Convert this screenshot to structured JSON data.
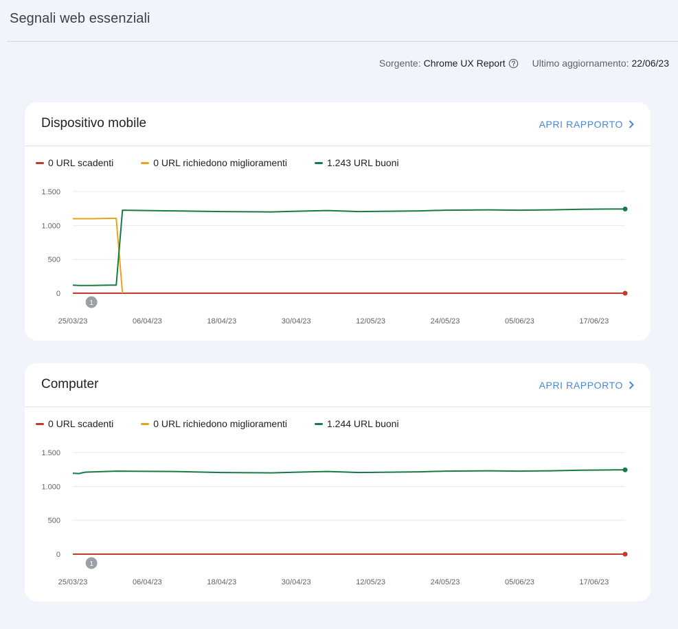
{
  "page": {
    "title": "Segnali web essenziali",
    "source_label": "Sorgente:",
    "source_value": "Chrome UX Report",
    "updated_label": "Ultimo aggiornamento:",
    "updated_value": "22/06/23"
  },
  "colors": {
    "poor": "#c5392b",
    "needs_improvement": "#e8a317",
    "good": "#177a45",
    "accent": "#4a87d6"
  },
  "icons": {
    "help": "help-circle-icon",
    "chevron": "chevron-right-icon"
  },
  "cards": [
    {
      "title": "Dispositivo mobile",
      "open_label": "APRI RAPPORTO",
      "legend": [
        "0 URL scadenti",
        "0 URL richiedono miglioramenti",
        "1.243 URL buoni"
      ],
      "annotation": "1"
    },
    {
      "title": "Computer",
      "open_label": "APRI RAPPORTO",
      "legend": [
        "0 URL scadenti",
        "0 URL richiedono miglioramenti",
        "1.244 URL buoni"
      ],
      "annotation": "1"
    }
  ],
  "chart_data": [
    {
      "type": "line",
      "x_ticks": [
        "25/03/23",
        "06/04/23",
        "18/04/23",
        "30/04/23",
        "12/05/23",
        "24/05/23",
        "05/06/23",
        "17/06/23"
      ],
      "y_ticks": [
        "0",
        "500",
        "1.000",
        "1.500"
      ],
      "ylim": [
        0,
        1500
      ],
      "x_range": [
        "25/03/23",
        "22/06/23"
      ],
      "grid": true,
      "annotations": [
        {
          "date": "28/03/23",
          "label": "1"
        }
      ],
      "series": [
        {
          "name": "0 URL scadenti",
          "color": "#c5392b",
          "points": [
            [
              "25/03/23",
              0
            ],
            [
              "22/06/23",
              0
            ]
          ]
        },
        {
          "name": "0 URL richiedono miglioramenti",
          "color": "#e8a317",
          "points": [
            [
              "25/03/23",
              1100
            ],
            [
              "28/03/23",
              1100
            ],
            [
              "31/03/23",
              1105
            ],
            [
              "01/04/23",
              1105
            ],
            [
              "02/04/23",
              0
            ]
          ]
        },
        {
          "name": "1.243 URL buoni",
          "color": "#177a45",
          "points": [
            [
              "25/03/23",
              120
            ],
            [
              "26/03/23",
              115
            ],
            [
              "28/03/23",
              115
            ],
            [
              "31/03/23",
              120
            ],
            [
              "01/04/23",
              120
            ],
            [
              "02/04/23",
              1225
            ],
            [
              "10/04/23",
              1215
            ],
            [
              "18/04/23",
              1205
            ],
            [
              "26/04/23",
              1200
            ],
            [
              "30/04/23",
              1210
            ],
            [
              "05/05/23",
              1220
            ],
            [
              "10/05/23",
              1205
            ],
            [
              "15/05/23",
              1210
            ],
            [
              "20/05/23",
              1215
            ],
            [
              "24/05/23",
              1225
            ],
            [
              "31/05/23",
              1230
            ],
            [
              "05/06/23",
              1225
            ],
            [
              "10/06/23",
              1230
            ],
            [
              "15/06/23",
              1240
            ],
            [
              "20/06/23",
              1243
            ],
            [
              "22/06/23",
              1243
            ]
          ]
        }
      ]
    },
    {
      "type": "line",
      "x_ticks": [
        "25/03/23",
        "06/04/23",
        "18/04/23",
        "30/04/23",
        "12/05/23",
        "24/05/23",
        "05/06/23",
        "17/06/23"
      ],
      "y_ticks": [
        "0",
        "500",
        "1.000",
        "1.500"
      ],
      "ylim": [
        0,
        1500
      ],
      "x_range": [
        "25/03/23",
        "22/06/23"
      ],
      "grid": true,
      "annotations": [
        {
          "date": "28/03/23",
          "label": "1"
        }
      ],
      "series": [
        {
          "name": "0 URL scadenti",
          "color": "#c5392b",
          "points": [
            [
              "25/03/23",
              0
            ],
            [
              "22/06/23",
              0
            ]
          ]
        },
        {
          "name": "0 URL richiedono miglioramenti",
          "color": "#e8a317",
          "points": []
        },
        {
          "name": "1.244 URL buoni",
          "color": "#177a45",
          "points": [
            [
              "25/03/23",
              1195
            ],
            [
              "26/03/23",
              1190
            ],
            [
              "27/03/23",
              1210
            ],
            [
              "01/04/23",
              1225
            ],
            [
              "10/04/23",
              1220
            ],
            [
              "18/04/23",
              1205
            ],
            [
              "26/04/23",
              1200
            ],
            [
              "30/04/23",
              1210
            ],
            [
              "05/05/23",
              1220
            ],
            [
              "10/05/23",
              1205
            ],
            [
              "15/05/23",
              1210
            ],
            [
              "20/05/23",
              1215
            ],
            [
              "24/05/23",
              1225
            ],
            [
              "31/05/23",
              1230
            ],
            [
              "05/06/23",
              1225
            ],
            [
              "10/06/23",
              1230
            ],
            [
              "15/06/23",
              1240
            ],
            [
              "20/06/23",
              1244
            ],
            [
              "22/06/23",
              1244
            ]
          ]
        }
      ]
    }
  ]
}
